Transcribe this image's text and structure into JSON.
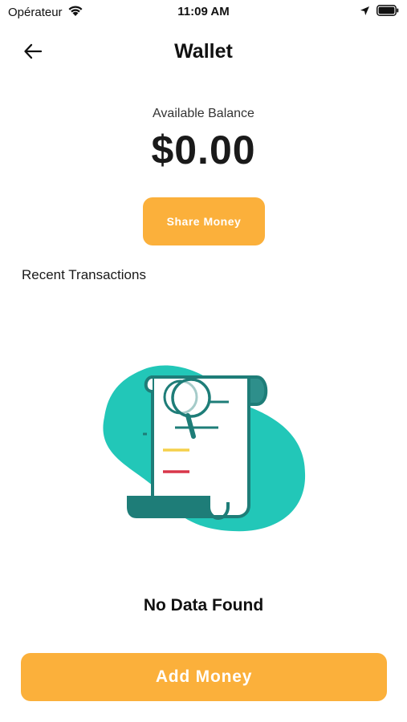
{
  "status_bar": {
    "carrier": "Opérateur",
    "time": "11:09 AM",
    "icons": [
      "wifi-icon",
      "location-arrow-icon",
      "battery-icon"
    ]
  },
  "header": {
    "title": "Wallet",
    "back_icon": "arrow-left-icon"
  },
  "balance": {
    "label": "Available Balance",
    "amount": "$0.00"
  },
  "share_button": {
    "label": "Share Money"
  },
  "transactions": {
    "title": "Recent Transactions",
    "empty_illustration": "receipt-magnifier-illustration",
    "empty_text": "No Data Found"
  },
  "add_money_button": {
    "label": "Add Money"
  },
  "colors": {
    "accent": "#fbb03b",
    "teal": "#22c7b8",
    "dark_teal": "#1e7d78",
    "text": "#111111"
  }
}
